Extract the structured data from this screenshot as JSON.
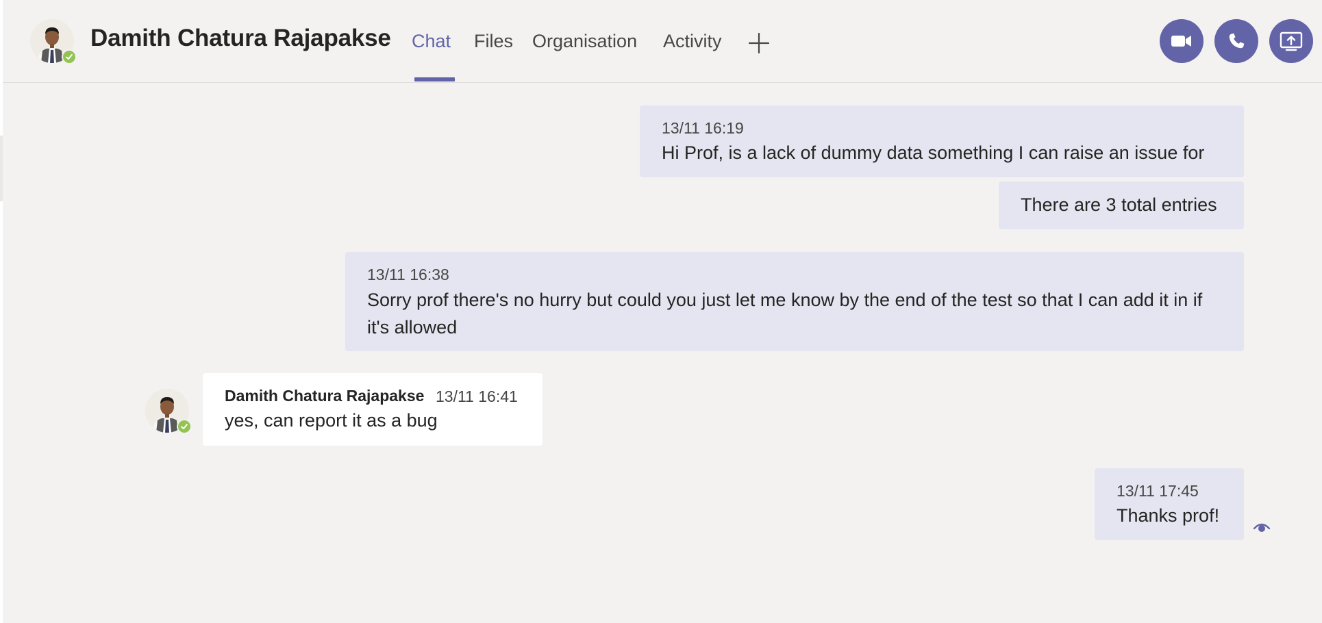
{
  "header": {
    "contact_name": "Damith Chatura Rajapakse",
    "presence": "available",
    "tabs": [
      {
        "label": "Chat",
        "active": true
      },
      {
        "label": "Files",
        "active": false
      },
      {
        "label": "Organisation",
        "active": false
      },
      {
        "label": "Activity",
        "active": false
      }
    ],
    "add_tab_icon": "plus-icon",
    "actions": [
      {
        "name": "video-call",
        "icon": "video-camera-icon"
      },
      {
        "name": "audio-call",
        "icon": "phone-icon"
      },
      {
        "name": "share-screen",
        "icon": "share-screen-icon"
      }
    ]
  },
  "messages": [
    {
      "direction": "outgoing",
      "timestamp": "13/11 16:19",
      "text": "Hi Prof, is a lack of dummy data something I can raise an issue for"
    },
    {
      "direction": "outgoing",
      "timestamp": "",
      "text": "There are 3 total entries"
    },
    {
      "direction": "outgoing",
      "timestamp": "13/11 16:38",
      "text": "Sorry prof there's no hurry but could you just let me know by the end of the test so that I can add it in if it's allowed"
    },
    {
      "direction": "incoming",
      "sender": "Damith Chatura Rajapakse",
      "timestamp": "13/11 16:41",
      "text": "yes, can report it as a bug"
    },
    {
      "direction": "outgoing",
      "timestamp": "13/11 17:45",
      "text": "Thanks prof!",
      "status_icon": "seen-eye-icon"
    }
  ],
  "colors": {
    "accent": "#6264a7",
    "background": "#f3f2f1",
    "outgoing_bubble": "#e5e5f1",
    "incoming_bubble": "#ffffff",
    "presence_available": "#92c353"
  }
}
